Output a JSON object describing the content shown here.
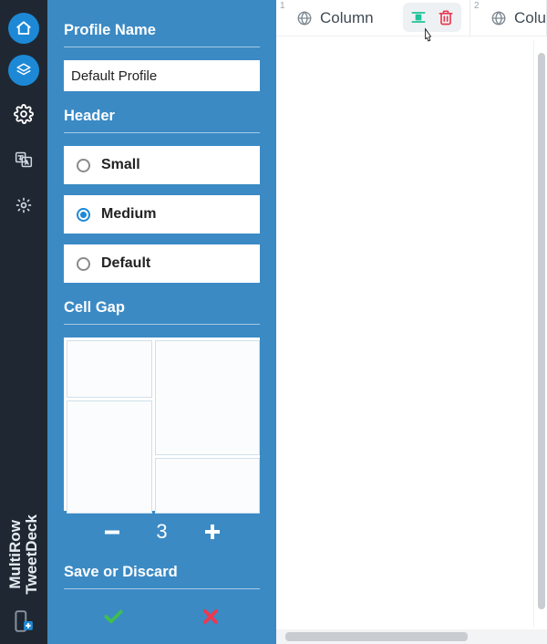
{
  "brand": {
    "line1": "MultiRow",
    "line2": "TweetDeck"
  },
  "rail": {
    "items": [
      {
        "name": "home-icon",
        "active": true
      },
      {
        "name": "layers-icon",
        "active": true
      },
      {
        "name": "gear-icon",
        "active": false
      },
      {
        "name": "translate-icon",
        "active": false
      },
      {
        "name": "brightness-icon",
        "active": false
      }
    ],
    "corner": {
      "name": "mobile-add-icon"
    }
  },
  "panel": {
    "profile_name_label": "Profile Name",
    "profile_name_value": "Default Profile",
    "header_label": "Header",
    "header_options": [
      {
        "label": "Small",
        "checked": false
      },
      {
        "label": "Medium",
        "checked": true
      },
      {
        "label": "Default",
        "checked": false
      }
    ],
    "cell_gap_label": "Cell Gap",
    "cell_gap_value": "3",
    "save_discard_label": "Save or Discard"
  },
  "columns": {
    "items": [
      {
        "num": "1",
        "title": "Column"
      },
      {
        "num": "2",
        "title": "Colu"
      }
    ],
    "toolbar": {
      "apply_icon": "align-tool-icon",
      "delete_icon": "trash-icon"
    }
  },
  "colors": {
    "accent": "#1d89d6",
    "panel": "#3b8ac4",
    "rail": "#1f2832",
    "ok": "#3fbf4f",
    "danger": "#e93a52",
    "tool_green": "#1fc29a"
  }
}
